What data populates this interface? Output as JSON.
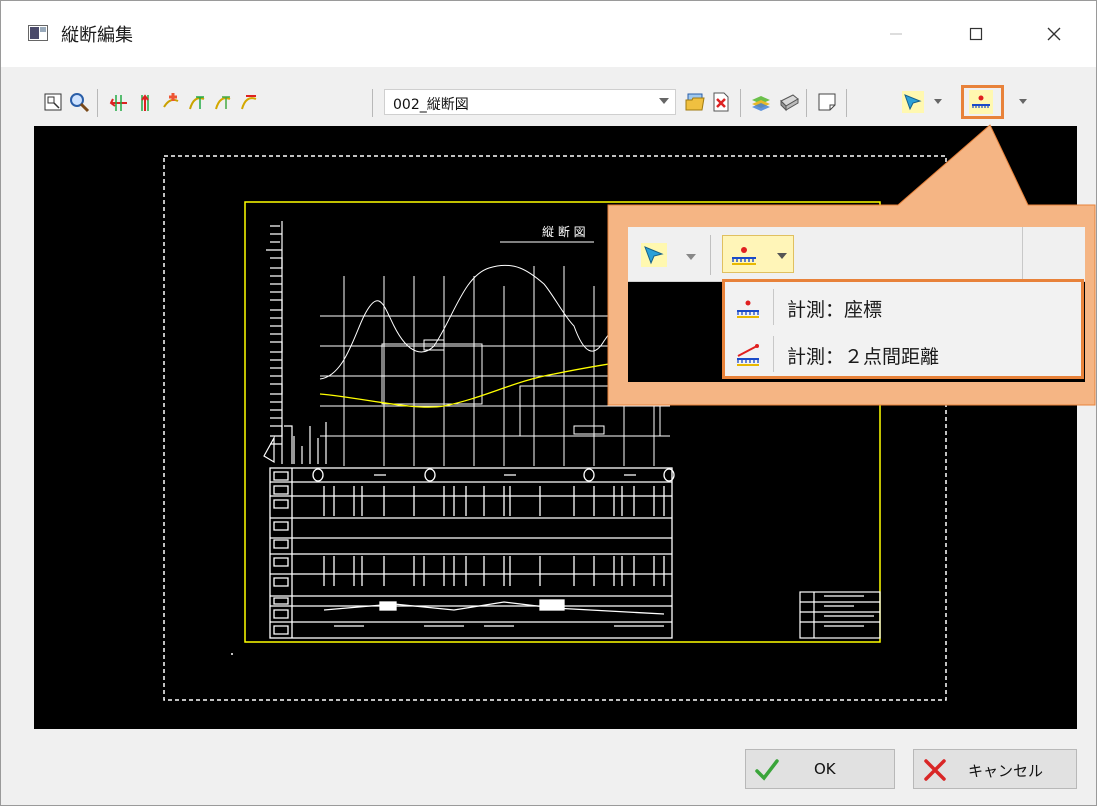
{
  "window": {
    "title": "縦断編集",
    "controls": {
      "minimize": "minimize",
      "maximize": "maximize",
      "close": "close"
    }
  },
  "toolbar": {
    "view_select_value": "002_縦断図",
    "buttons": [
      "zoom-extents-icon",
      "zoom-icon",
      "arrow-red-icon",
      "arrow-red-up-icon",
      "add-point-icon",
      "curve-icon",
      "curve-yellow-icon",
      "curve-red-icon",
      "open-folder-icon",
      "delete-file-icon",
      "layers-icon",
      "print-icon",
      "sheet-icon",
      "select-pointer-icon",
      "measure-icon"
    ]
  },
  "drawing": {
    "title": "縦 断 図"
  },
  "popup": {
    "menu_items": [
      {
        "label": "計測：座標",
        "icon": "measure-coordinate-icon"
      },
      {
        "label": "計測：２点間距離",
        "icon": "measure-distance-icon"
      }
    ]
  },
  "footer": {
    "ok_label": "OK",
    "cancel_label": "キャンセル"
  },
  "colors": {
    "highlight": "#e8823a",
    "callout_fill": "#f5b584",
    "drawing_frame": "#ffff00",
    "drawing_line": "#ffffff",
    "ok_check": "#3aa53a",
    "cancel_x": "#d92626"
  }
}
